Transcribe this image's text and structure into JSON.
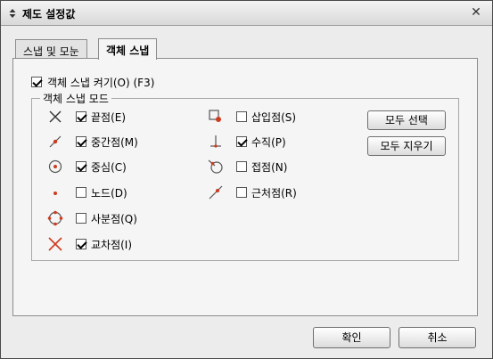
{
  "window": {
    "title": "제도 설정값"
  },
  "tabs": [
    {
      "label": "스냅 및 모눈",
      "active": false
    },
    {
      "label": "객체 스냅",
      "active": true
    }
  ],
  "snap_on": {
    "label": "객체 스냅 켜기(O) (F3)",
    "checked": true
  },
  "group_title": "객체 스냅 모드",
  "modes_left": [
    {
      "label": "끝점(E)",
      "checked": true,
      "icon": "endpoint-icon"
    },
    {
      "label": "중간점(M)",
      "checked": true,
      "icon": "midpoint-icon"
    },
    {
      "label": "중심(C)",
      "checked": true,
      "icon": "center-icon"
    },
    {
      "label": "노드(D)",
      "checked": false,
      "icon": "node-icon"
    },
    {
      "label": "사분점(Q)",
      "checked": false,
      "icon": "quadrant-icon"
    },
    {
      "label": "교차점(I)",
      "checked": true,
      "icon": "intersection-icon"
    }
  ],
  "modes_right": [
    {
      "label": "삽입점(S)",
      "checked": false,
      "icon": "insertion-icon"
    },
    {
      "label": "수직(P)",
      "checked": true,
      "icon": "perpendicular-icon"
    },
    {
      "label": "접점(N)",
      "checked": false,
      "icon": "tangent-icon"
    },
    {
      "label": "근처점(R)",
      "checked": false,
      "icon": "nearest-icon"
    }
  ],
  "buttons": {
    "select_all": "모두 선택",
    "clear_all": "모두 지우기",
    "ok": "확인",
    "cancel": "취소"
  },
  "colors": {
    "accent": "#d03a1e"
  }
}
